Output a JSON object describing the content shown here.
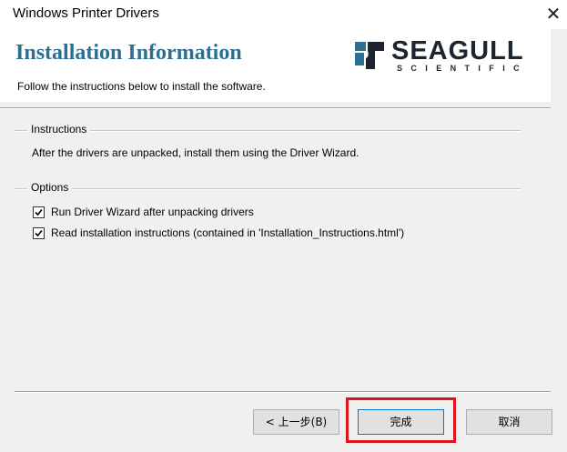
{
  "window": {
    "title": "Windows Printer Drivers",
    "close_glyph": "✕"
  },
  "header": {
    "heading": "Installation Information",
    "subtext": "Follow the instructions below to install the software.",
    "logo": {
      "brand": "SEAGULL",
      "sub": "SCIENTIFIC",
      "colors": {
        "mark": "#2c6f92",
        "text": "#1d2530"
      }
    }
  },
  "instructions": {
    "group_label": "Instructions",
    "text": "After the drivers are unpacked, install them using the Driver Wizard."
  },
  "options": {
    "group_label": "Options",
    "items": [
      {
        "label": "Run Driver Wizard after unpacking drivers",
        "checked": true
      },
      {
        "label": "Read installation instructions (contained in 'Installation_Instructions.html')",
        "checked": true
      }
    ]
  },
  "buttons": {
    "back": "< 上一步(B)",
    "finish": "完成",
    "cancel": "取消"
  },
  "colors": {
    "heading": "#2c6f92",
    "highlight": "#e0141c",
    "dialog_bg": "#f0f0f0"
  }
}
